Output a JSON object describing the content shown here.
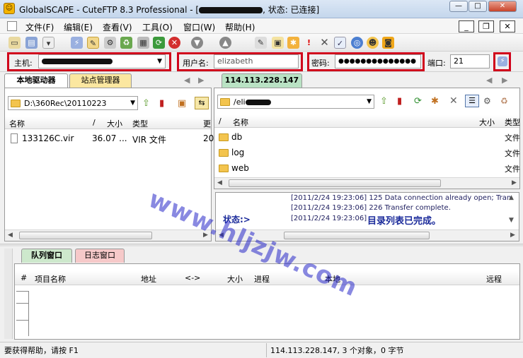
{
  "window": {
    "title_prefix": "GlobalSCAPE - CuteFTP 8.3 Professional - [",
    "title_status": ", 状态: 已连接]",
    "min_label": "—",
    "max_label": "□",
    "close_label": "✕"
  },
  "menu": {
    "items": [
      "文件(F)",
      "编辑(E)",
      "查看(V)",
      "工具(O)",
      "窗口(W)",
      "帮助(H)"
    ],
    "mdi_min": "_",
    "mdi_restore": "❐",
    "mdi_close": "✕"
  },
  "quickconnect": {
    "host_label": "主机:",
    "user_label": "用户名:",
    "user_value": "elizabeth",
    "password_label": "密码:",
    "password_value": "●●●●●●●●●●●●●●",
    "port_label": "端口:",
    "port_value": "21"
  },
  "local": {
    "tab_drives": "本地驱动器",
    "tab_sites": "站点管理器",
    "path": "D:\\360Rec\\20110223",
    "columns": [
      "名称",
      "/",
      "大小",
      "类型",
      "更"
    ],
    "files": [
      {
        "name": "133126C.vir",
        "size": "36.07 ...",
        "type": "VIR 文件",
        "date": "20"
      }
    ]
  },
  "remote": {
    "tab_label": "114.113.228.147",
    "path": "/eli",
    "columns": [
      "/",
      "名称",
      "大小",
      "类型"
    ],
    "files": [
      {
        "name": "db",
        "type": "文件"
      },
      {
        "name": "log",
        "type": "文件"
      },
      {
        "name": "web",
        "type": "文件"
      }
    ]
  },
  "log": {
    "lines": [
      "[2011/2/24 19:23:06] 125 Data connection already open; Tran",
      "[2011/2/24 19:23:06] 226 Transfer complete.",
      "[2011/2/24 19:23:06]"
    ],
    "status_label": "状态:>",
    "status_message": "目录列表已完成。"
  },
  "queue": {
    "tab_queue": "队列窗口",
    "tab_log": "日志窗口",
    "columns": [
      "#",
      "项目名称",
      "地址",
      "<->",
      "大小",
      "进程",
      "本地",
      "远程"
    ]
  },
  "statusbar": {
    "help_text": "要获得帮助，请按 F1",
    "connection_text": "114.113.228.147, 3 个对象，0 字节"
  },
  "watermark": {
    "text": "www.hljzjw.com"
  }
}
